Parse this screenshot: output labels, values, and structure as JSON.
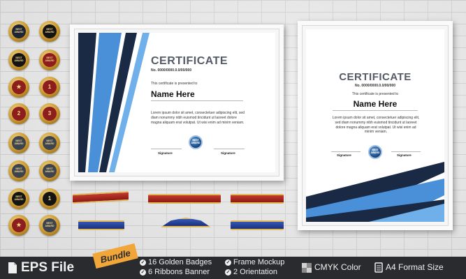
{
  "certificate_left": {
    "title": "CERTIFICATE",
    "number": "No. 0000/0000.0.0/00/000",
    "presented_to": "This certificate is presented to",
    "name": "Name Here",
    "body": "Lorem ipsum dolor sit amet, consectetuer adipiscing elit, sed diam nonummy nibh euismod tincidunt ut laoreet dolore magna aliquam erat volutpat. Ut wisi enim ad minim veniam.",
    "signature_left": "Signature",
    "signature_right": "Signature",
    "seal_text": "BEST AWARD"
  },
  "certificate_right": {
    "title": "CERTIFICATE",
    "number": "No. 0000/0000.0.0/00/000",
    "presented_to": "This certificate is presented to",
    "name": "Name Here",
    "body": "Lorem ipsum dolor sit amet, consectetuer adipiscing elit, sed diam nonummy nibh euismod tincidunt ut laoreet dolore magna aliquam erat volutpat. Ut wisi enim ad minim veniam.",
    "signature_left": "Signature",
    "signature_right": "Signature",
    "seal_text": "BEST AWARD"
  },
  "badges": {
    "best": "BEST",
    "award": "AWARD",
    "rank1": "1",
    "rank2": "2",
    "rank3": "3",
    "star": "★"
  },
  "footer": {
    "eps": "EPS File",
    "bundle": "Bundle",
    "item1": "16 Golden Badges",
    "item2": "6  Ribbons Banner",
    "item3": "Frame Mockup",
    "item4": "2 Orientation",
    "cmyk": "CMYK Color",
    "a4": "A4 Format Size"
  },
  "colors": {
    "accent_blue": "#4a90d9",
    "navy": "#1a2a44",
    "gold": "#c9962d",
    "bar_bg": "#2a2b2e",
    "bundle_tag": "#f1a63a"
  }
}
